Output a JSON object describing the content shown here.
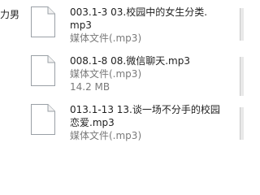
{
  "left_fragment": "力男",
  "files": [
    {
      "name_line1": "003.1-3 03.校园中的女生分类.",
      "name_line2": "mp3",
      "type": "媒体文件(.mp3)",
      "size": ""
    },
    {
      "name_line1": "008.1-8 08.微信聊天.mp3",
      "name_line2": "",
      "type": "媒体文件(.mp3)",
      "size": "14.2 MB"
    },
    {
      "name_line1": "013.1-13 13.谈一场不分手的校园",
      "name_line2": "恋爱.mp3",
      "type": "媒体文件(.mp3)",
      "size": ""
    }
  ],
  "icons": {
    "file": "document-icon"
  }
}
